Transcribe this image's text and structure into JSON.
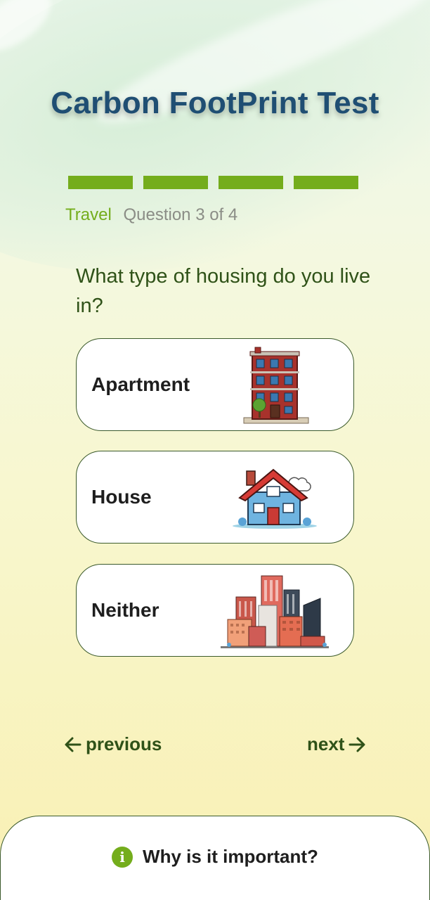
{
  "header": {
    "title": "Carbon FootPrint Test"
  },
  "progress": {
    "current": 3,
    "total": 4,
    "segments_filled": 4
  },
  "meta": {
    "category": "Travel",
    "question_count": "Question 3 of 4"
  },
  "question": {
    "text": "What type of housing do you live in?"
  },
  "options": [
    {
      "label": "Apartment",
      "icon": "apartment-building-icon"
    },
    {
      "label": "House",
      "icon": "house-icon"
    },
    {
      "label": "Neither",
      "icon": "city-buildings-icon"
    }
  ],
  "nav": {
    "previous_label": "previous",
    "next_label": "next"
  },
  "info": {
    "label": "Why is it important?",
    "icon": "info-icon"
  },
  "colors": {
    "accent": "#74ad1c",
    "title": "#1f4e73",
    "text_dark": "#2f5218"
  }
}
